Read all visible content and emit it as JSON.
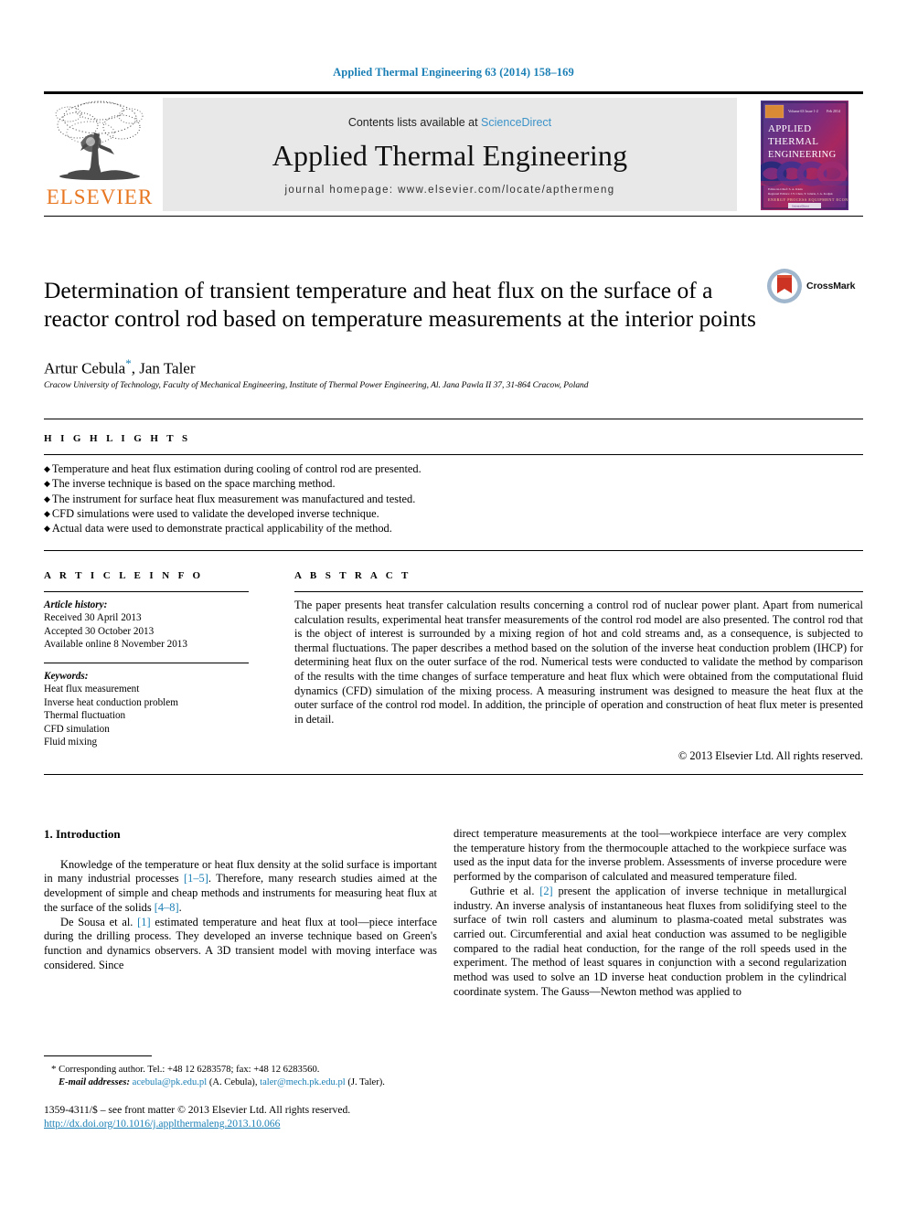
{
  "running_head": "Applied Thermal Engineering 63 (2014) 158–169",
  "masthead": {
    "publisher": "ELSEVIER",
    "contents_prefix": "Contents lists available at ",
    "contents_link": "ScienceDirect",
    "journal_title": "Applied Thermal Engineering",
    "homepage": "journal homepage: www.elsevier.com/locate/apthermeng",
    "cover": {
      "title_line1": "APPLIED",
      "title_line2": "THERMAL",
      "title_line3": "ENGINEERING"
    }
  },
  "article": {
    "title": "Determination of transient temperature and heat flux on the surface of a reactor control rod based on temperature measurements at the interior points",
    "crossmark_label": "CrossMark",
    "authors_plain": "Artur Cebula",
    "authors_rest": ", Jan Taler",
    "corresponding_mark": "*",
    "affiliation": "Cracow University of Technology, Faculty of Mechanical Engineering, Institute of Thermal Power Engineering, Al. Jana Pawla II 37, 31-864 Cracow, Poland"
  },
  "highlights": {
    "heading": "H I G H L I G H T S",
    "items": [
      "Temperature and heat flux estimation during cooling of control rod are presented.",
      "The inverse technique is based on the space marching method.",
      "The instrument for surface heat flux measurement was manufactured and tested.",
      "CFD simulations were used to validate the developed inverse technique.",
      "Actual data were used to demonstrate practical applicability of the method."
    ]
  },
  "article_info": {
    "heading": "A R T I C L E  I N F O",
    "history_label": "Article history:",
    "history": [
      "Received 30 April 2013",
      "Accepted 30 October 2013",
      "Available online 8 November 2013"
    ],
    "keywords_label": "Keywords:",
    "keywords": [
      "Heat flux measurement",
      "Inverse heat conduction problem",
      "Thermal fluctuation",
      "CFD simulation",
      "Fluid mixing"
    ]
  },
  "abstract": {
    "heading": "A B S T R A C T",
    "text": "The paper presents heat transfer calculation results concerning a control rod of nuclear power plant. Apart from numerical calculation results, experimental heat transfer measurements of the control rod model are also presented. The control rod that is the object of interest is surrounded by a mixing region of hot and cold streams and, as a consequence, is subjected to thermal fluctuations. The paper describes a method based on the solution of the inverse heat conduction problem (IHCP) for determining heat flux on the outer surface of the rod. Numerical tests were conducted to validate the method by comparison of the results with the time changes of surface temperature and heat flux which were obtained from the computational fluid dynamics (CFD) simulation of the mixing process. A measuring instrument was designed to measure the heat flux at the outer surface of the control rod model. In addition, the principle of operation and construction of heat flux meter is presented in detail.",
    "copyright": "© 2013 Elsevier Ltd. All rights reserved."
  },
  "body": {
    "section_number_title": "1. Introduction",
    "left_para_1_a": "Knowledge of the temperature or heat flux density at the solid surface is important in many industrial processes ",
    "left_para_1_ref1": "[1–5]",
    "left_para_1_b": ". Therefore, many research studies aimed at the development of simple and cheap methods and instruments for measuring heat flux at the surface of the solids ",
    "left_para_1_ref2": "[4–8]",
    "left_para_1_c": ".",
    "left_para_2_a": "De Sousa et al. ",
    "left_para_2_ref": "[1]",
    "left_para_2_b": " estimated temperature and heat flux at tool—piece interface during the drilling process. They developed an inverse technique based on Green's function and dynamics observers. A 3D transient model with moving interface was considered. Since",
    "right_para_1": "direct temperature measurements at the tool—workpiece interface are very complex the temperature history from the thermocouple attached to the workpiece surface was used as the input data for the inverse problem. Assessments of inverse procedure were performed by the comparison of calculated and measured temperature filed.",
    "right_para_2_a": "Guthrie et al. ",
    "right_para_2_ref": "[2]",
    "right_para_2_b": " present the application of inverse technique in metallurgical industry. An inverse analysis of instantaneous heat fluxes from solidifying steel to the surface of twin roll casters and aluminum to plasma-coated metal substrates was carried out. Circumferential and axial heat conduction was assumed to be negligible compared to the radial heat conduction, for the range of the roll speeds used in the experiment. The method of least squares in conjunction with a second regularization method was used to solve an 1D inverse heat conduction problem in the cylindrical coordinate system. The Gauss—Newton method was applied to"
  },
  "footnote": {
    "star": "*",
    "corresponding": " Corresponding author. Tel.: +48 12 6283578; fax: +48 12 6283560.",
    "email_label": "E-mail addresses:",
    "email1": "acebula@pk.edu.pl",
    "email1_name": " (A. Cebula), ",
    "email2": "taler@mech.pk.edu.pl",
    "email2_name": " (J. Taler)."
  },
  "imprint": {
    "line1": "1359-4311/$ – see front matter © 2013 Elsevier Ltd. All rights reserved.",
    "doi": "http://dx.doi.org/10.1016/j.applthermaleng.2013.10.066"
  },
  "colors": {
    "link_blue": "#1a7fb5",
    "sciencedirect_blue": "#3b93c9",
    "elsevier_orange": "#e87722",
    "band_gray": "#e8e8e8"
  }
}
